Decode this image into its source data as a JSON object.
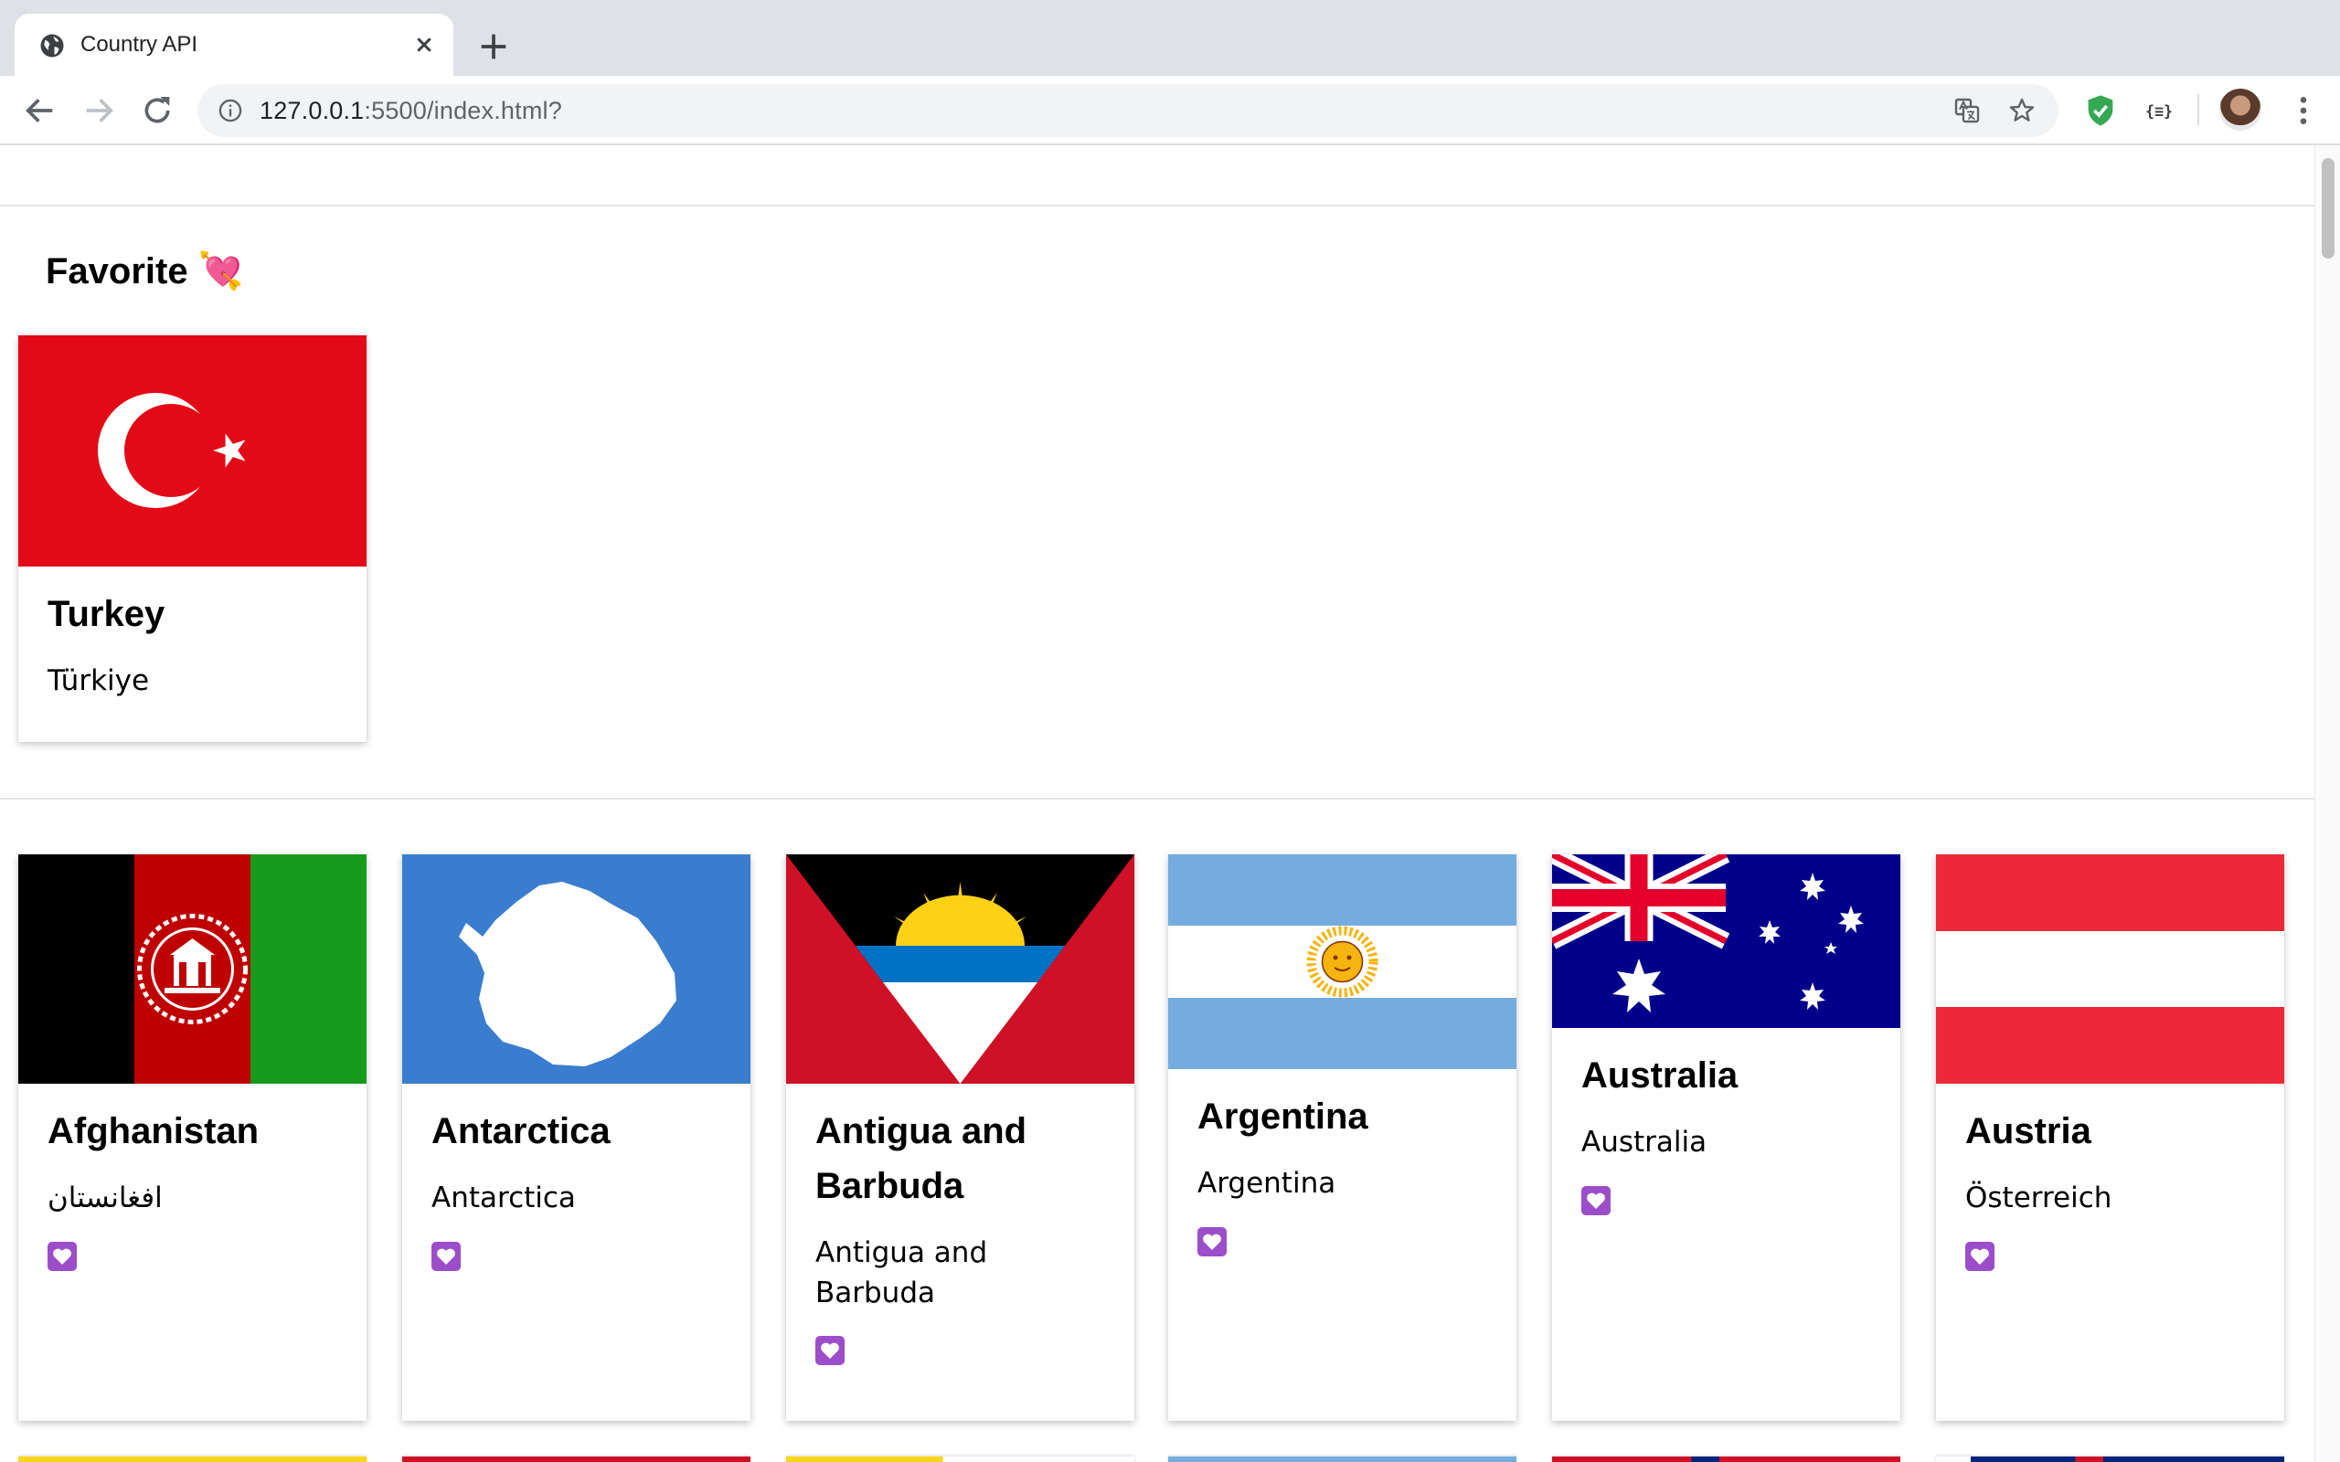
{
  "browser": {
    "tab_title": "Country API",
    "url_host": "127.0.0.1",
    "url_rest": ":5500/index.html?"
  },
  "favorites": {
    "heading": "Favorite 💘",
    "items": [
      {
        "name": "Turkey",
        "native": "Türkiye",
        "flag": "turkey-flag"
      }
    ]
  },
  "countries": [
    {
      "name": "Afghanistan",
      "native": "افغانستان",
      "flag": "afghanistan-flag"
    },
    {
      "name": "Antarctica",
      "native": "Antarctica",
      "flag": "antarctica-flag"
    },
    {
      "name": "Antigua and Barbuda",
      "native": "Antigua and Barbuda",
      "flag": "antigua-and-barbuda-flag"
    },
    {
      "name": "Argentina",
      "native": "Argentina",
      "flag": "argentina-flag"
    },
    {
      "name": "Australia",
      "native": "Australia",
      "flag": "australia-flag"
    },
    {
      "name": "Austria",
      "native": "Österreich",
      "flag": "austria-flag"
    }
  ],
  "colors": {
    "tabstrip": "#dee1e6",
    "heart": "#9b4dca",
    "turkey_red": "#e30a17"
  }
}
